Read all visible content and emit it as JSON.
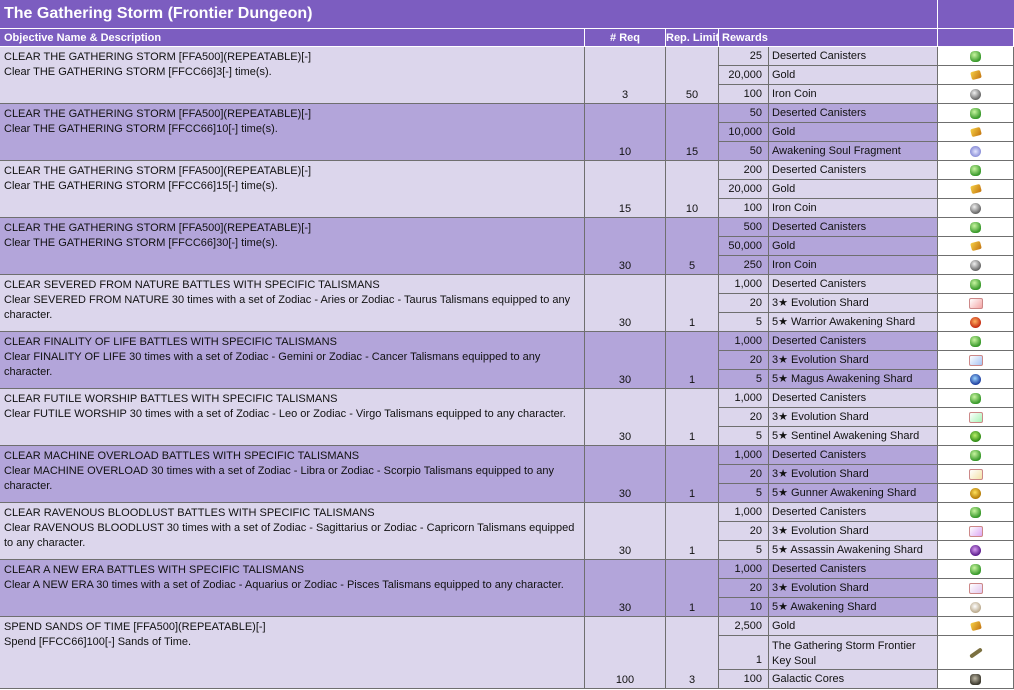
{
  "title": "The Gathering Storm (Frontier Dungeon)",
  "headers": {
    "objective": "Objective Name & Description",
    "req": "# Req",
    "limit": "Rep. Limit",
    "rewards": "Rewards"
  },
  "rows": [
    {
      "name": "CLEAR THE GATHERING STORM [FFA500](REPEATABLE)[-]",
      "desc": "Clear THE GATHERING STORM [FFCC66]3[-] time(s).",
      "req": "3",
      "limit": "50",
      "rewards": [
        {
          "qty": "25",
          "item": "Deserted Canisters",
          "icon": "canister-icon"
        },
        {
          "qty": "20,000",
          "item": "Gold",
          "icon": "gold-icon"
        },
        {
          "qty": "100",
          "item": "Iron Coin",
          "icon": "iron-coin-icon"
        }
      ]
    },
    {
      "name": "CLEAR THE GATHERING STORM [FFA500](REPEATABLE)[-]",
      "desc": "Clear THE GATHERING STORM [FFCC66]10[-] time(s).",
      "req": "10",
      "limit": "15",
      "rewards": [
        {
          "qty": "50",
          "item": "Deserted Canisters",
          "icon": "canister-icon"
        },
        {
          "qty": "10,000",
          "item": "Gold",
          "icon": "gold-icon"
        },
        {
          "qty": "50",
          "item": "Awakening Soul Fragment",
          "icon": "soul-fragment-icon"
        }
      ]
    },
    {
      "name": "CLEAR THE GATHERING STORM [FFA500](REPEATABLE)[-]",
      "desc": "Clear THE GATHERING STORM [FFCC66]15[-] time(s).",
      "req": "15",
      "limit": "10",
      "rewards": [
        {
          "qty": "200",
          "item": "Deserted Canisters",
          "icon": "canister-icon"
        },
        {
          "qty": "20,000",
          "item": "Gold",
          "icon": "gold-icon"
        },
        {
          "qty": "100",
          "item": "Iron Coin",
          "icon": "iron-coin-icon"
        }
      ]
    },
    {
      "name": "CLEAR THE GATHERING STORM [FFA500](REPEATABLE)[-]",
      "desc": "Clear THE GATHERING STORM [FFCC66]30[-] time(s).",
      "req": "30",
      "limit": "5",
      "rewards": [
        {
          "qty": "500",
          "item": "Deserted Canisters",
          "icon": "canister-icon"
        },
        {
          "qty": "50,000",
          "item": "Gold",
          "icon": "gold-icon"
        },
        {
          "qty": "250",
          "item": "Iron Coin",
          "icon": "iron-coin-icon"
        }
      ]
    },
    {
      "name": "CLEAR SEVERED FROM NATURE BATTLES WITH SPECIFIC TALISMANS",
      "desc": "Clear SEVERED FROM NATURE 30 times with a set of Zodiac - Aries or Zodiac - Taurus Talismans equipped to any character.",
      "req": "30",
      "limit": "1",
      "rewards": [
        {
          "qty": "1,000",
          "item": "Deserted Canisters",
          "icon": "canister-icon"
        },
        {
          "qty": "20",
          "item": "3★ Evolution Shard",
          "icon": "evolution-shard-icon"
        },
        {
          "qty": "5",
          "item": "5★ Warrior Awakening Shard",
          "icon": "warrior-shard-icon"
        }
      ]
    },
    {
      "name": "CLEAR FINALITY OF LIFE BATTLES WITH SPECIFIC TALISMANS",
      "desc": "Clear FINALITY OF LIFE 30 times with a set of Zodiac - Gemini or Zodiac - Cancer Talismans equipped to any character.",
      "req": "30",
      "limit": "1",
      "rewards": [
        {
          "qty": "1,000",
          "item": "Deserted Canisters",
          "icon": "canister-icon"
        },
        {
          "qty": "20",
          "item": "3★ Evolution Shard",
          "icon": "evolution-shard-icon"
        },
        {
          "qty": "5",
          "item": "5★ Magus Awakening Shard",
          "icon": "magus-shard-icon"
        }
      ]
    },
    {
      "name": "CLEAR FUTILE WORSHIP BATTLES WITH SPECIFIC TALISMANS",
      "desc": "Clear FUTILE WORSHIP 30 times with a set of Zodiac - Leo or Zodiac - Virgo Talismans equipped to any character.",
      "req": "30",
      "limit": "1",
      "rewards": [
        {
          "qty": "1,000",
          "item": "Deserted Canisters",
          "icon": "canister-icon"
        },
        {
          "qty": "20",
          "item": "3★ Evolution Shard",
          "icon": "evolution-shard-icon"
        },
        {
          "qty": "5",
          "item": "5★ Sentinel Awakening Shard",
          "icon": "sentinel-shard-icon"
        }
      ]
    },
    {
      "name": "CLEAR MACHINE OVERLOAD BATTLES WITH SPECIFIC TALISMANS",
      "desc": "Clear MACHINE OVERLOAD 30 times with a set of Zodiac - Libra or Zodiac - Scorpio Talismans equipped to any character.",
      "req": "30",
      "limit": "1",
      "rewards": [
        {
          "qty": "1,000",
          "item": "Deserted Canisters",
          "icon": "canister-icon"
        },
        {
          "qty": "20",
          "item": "3★ Evolution Shard",
          "icon": "evolution-shard-icon"
        },
        {
          "qty": "5",
          "item": "5★ Gunner Awakening Shard",
          "icon": "gunner-shard-icon"
        }
      ]
    },
    {
      "name": "CLEAR RAVENOUS BLOODLUST BATTLES WITH SPECIFIC TALISMANS",
      "desc": "Clear RAVENOUS BLOODLUST 30 times with a set of Zodiac - Sagittarius or Zodiac - Capricorn Talismans equipped to any character.",
      "req": "30",
      "limit": "1",
      "rewards": [
        {
          "qty": "1,000",
          "item": "Deserted Canisters",
          "icon": "canister-icon"
        },
        {
          "qty": "20",
          "item": "3★ Evolution Shard",
          "icon": "evolution-shard-icon"
        },
        {
          "qty": "5",
          "item": "5★ Assassin Awakening Shard",
          "icon": "assassin-shard-icon"
        }
      ]
    },
    {
      "name": "CLEAR A NEW ERA BATTLES WITH SPECIFIC TALISMANS",
      "desc": "Clear A NEW ERA 30 times with a set of Zodiac - Aquarius or Zodiac - Pisces Talismans equipped to any character.",
      "req": "30",
      "limit": "1",
      "rewards": [
        {
          "qty": "1,000",
          "item": "Deserted Canisters",
          "icon": "canister-icon"
        },
        {
          "qty": "20",
          "item": "3★ Evolution Shard",
          "icon": "evolution-shard-icon"
        },
        {
          "qty": "10",
          "item": "5★ Awakening Shard",
          "icon": "awakening-shard-icon"
        }
      ]
    },
    {
      "name": "SPEND SANDS OF TIME [FFA500](REPEATABLE)[-]",
      "desc": "Spend [FFCC66]100[-] Sands of Time.",
      "req": "100",
      "limit": "3",
      "rewards": [
        {
          "qty": "2,500",
          "item": "Gold",
          "icon": "gold-icon"
        },
        {
          "qty": "1",
          "item": "The Gathering Storm Frontier Key Soul",
          "icon": "key-soul-icon"
        },
        {
          "qty": "100",
          "item": "Galactic Cores",
          "icon": "galactic-core-icon"
        }
      ]
    }
  ],
  "colors": {
    "header": "#7c5dc0",
    "row_odd": "#dcd6ec",
    "row_even": "#b3a5da",
    "grid": "#6f6f6f"
  }
}
